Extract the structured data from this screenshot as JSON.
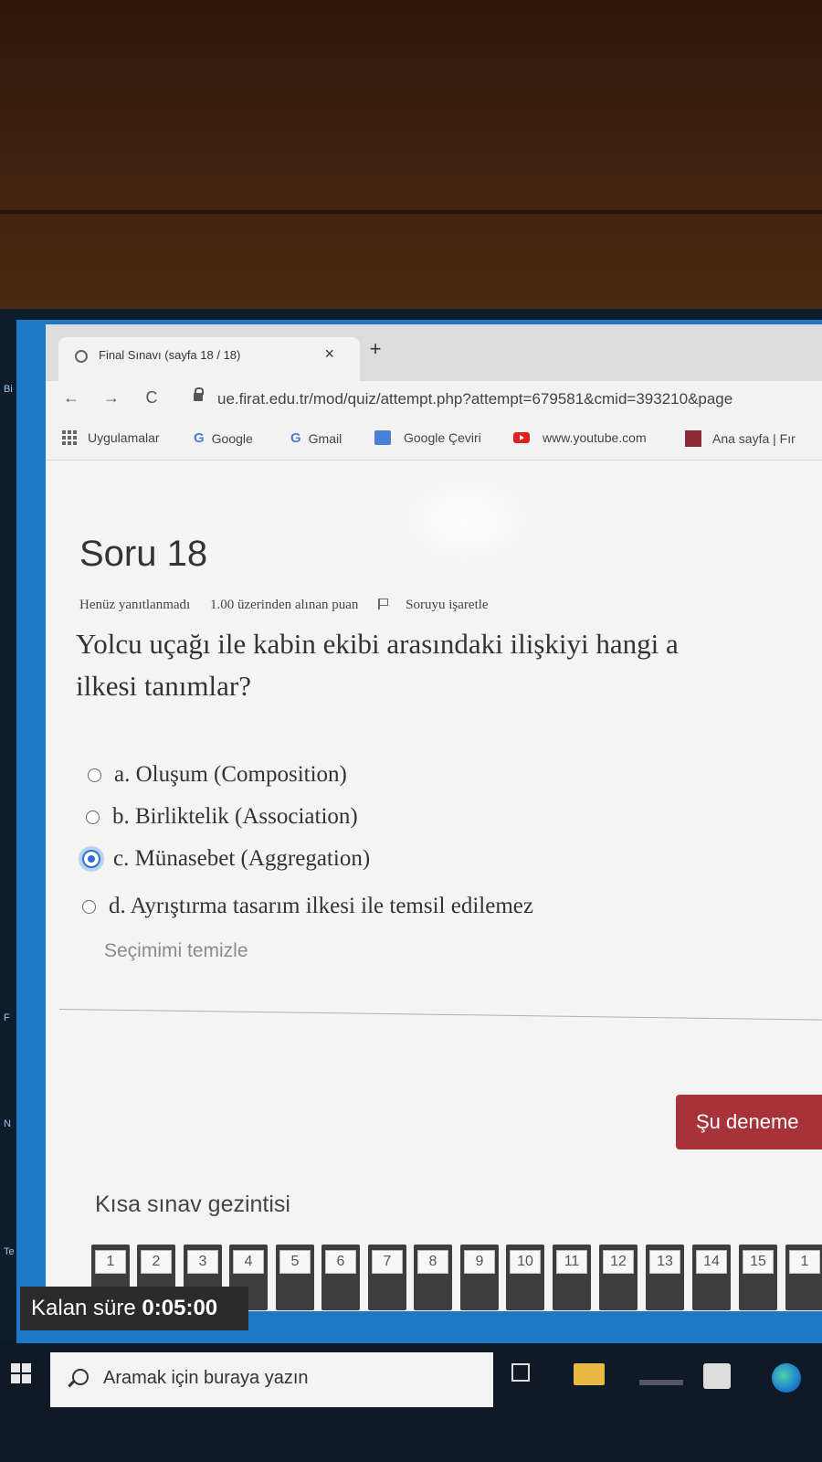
{
  "browser": {
    "tab_title": "Final Sınavı (sayfa 18 / 18)",
    "tab_close": "×",
    "new_tab": "+",
    "url": "ue.firat.edu.tr/mod/quiz/attempt.php?attempt=679581&cmid=393210&page",
    "nav": {
      "back": "←",
      "forward": "→",
      "reload": "C"
    },
    "bookmarks": [
      {
        "label": "Uygulamalar",
        "icon": "apps-grid-icon"
      },
      {
        "label": "Google",
        "icon": "google-icon",
        "glyph": "G"
      },
      {
        "label": "Gmail",
        "icon": "google-icon",
        "glyph": "G"
      },
      {
        "label": "Google Çeviri",
        "icon": "google-translate-icon"
      },
      {
        "label": "www.youtube.com",
        "icon": "youtube-icon"
      },
      {
        "label": "Ana sayfa | Fır",
        "icon": "firat-icon"
      }
    ]
  },
  "question": {
    "title": "Soru 18",
    "status": "Henüz yanıtlanmadı",
    "points": "1.00 üzerinden alınan puan",
    "flag": "Soruyu işaretle",
    "text_line1": "Yolcu uçağı ile kabin ekibi arasındaki ilişkiyi hangi a",
    "text_line2": "ilkesi tanımlar?",
    "answers": [
      {
        "label": "a. Oluşum (Composition)",
        "selected": false
      },
      {
        "label": "b. Birliktelik (Association)",
        "selected": false
      },
      {
        "label": "c. Münasebet (Aggregation)",
        "selected": true
      },
      {
        "label": "d. Ayrıştırma tasarım ilkesi ile temsil edilemez",
        "selected": false
      }
    ],
    "clear_choice": "Seçimimi temizle"
  },
  "next_button": "Şu deneme",
  "quiz_nav": {
    "title": "Kısa sınav gezintisi",
    "pages": [
      "1",
      "2",
      "3",
      "4",
      "5",
      "6",
      "7",
      "8",
      "9",
      "10",
      "11",
      "12",
      "13",
      "14",
      "15",
      "1"
    ]
  },
  "timer": {
    "label": "Kalan süre",
    "value": "0:05:00"
  },
  "taskbar": {
    "search_placeholder": "Aramak için buraya yazın"
  },
  "edge_letters": [
    "Bi",
    "F",
    "N",
    "Te"
  ],
  "colors": {
    "accent_button": "#a8323a",
    "radio_selected": "#2f6fd6",
    "desktop": "#1e78c8"
  }
}
